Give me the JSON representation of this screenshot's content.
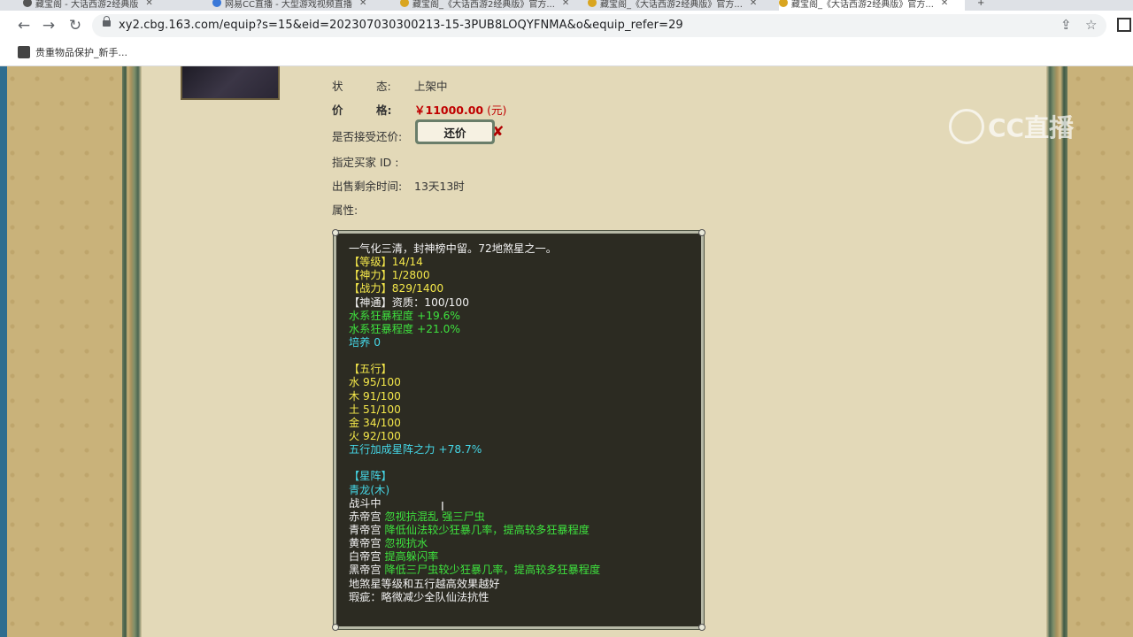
{
  "browser": {
    "tabs": [
      {
        "label": "藏宝阁 - 大话西游2经典版"
      },
      {
        "label": "网易CC直播 - 大型游戏视频直播"
      },
      {
        "label": "藏宝阁_《大话西游2经典版》官方..."
      },
      {
        "label": "藏宝阁_《大话西游2经典版》官方..."
      },
      {
        "label": "藏宝阁_《大话西游2经典版》官方..."
      }
    ],
    "url": "xy2.cbg.163.com/equip?s=15&eid=202307030300213-15-3PUB8LOQYFNMA&o&equip_refer=29",
    "bookmark": "贵重物品保护_新手..."
  },
  "watermark": {
    "text": "CC直播"
  },
  "item": {
    "status_label": "状　　　态:",
    "status_value": "上架中",
    "price_label": "价　　　格:",
    "price_value": "￥11000.00",
    "price_unit": "(元)",
    "counter_label": "是否接受还价:",
    "counter_button": "还价",
    "counter_mark": "✘",
    "buyer_label": "指定买家 ID :",
    "time_label": "出售剩余时间:",
    "time_value": "13天13时",
    "attr_label": "属性:"
  },
  "attributes": [
    {
      "text": "一气化三清，封神榜中留。72地煞星之一。",
      "color": "#f2f2f2"
    },
    {
      "text": "【等级】14/14",
      "color": "#f5e84a"
    },
    {
      "text": "【神力】1/2800",
      "color": "#f5e84a"
    },
    {
      "text": "【战力】829/1400",
      "color": "#f5e84a"
    },
    {
      "text": "【神通】资质：100/100",
      "color": "#f2f2f2"
    },
    {
      "text": "水系狂暴程度 +19.6%",
      "color": "#3ee23e"
    },
    {
      "text": "水系狂暴程度 +21.0%",
      "color": "#3ee23e"
    },
    {
      "text": "培养 0",
      "color": "#45d6e6"
    },
    {
      "text": "",
      "color": "#f2f2f2"
    },
    {
      "text": "【五行】",
      "color": "#f5e84a"
    },
    {
      "text": "水 95/100",
      "color": "#f5e84a"
    },
    {
      "text": "木 91/100",
      "color": "#f5e84a"
    },
    {
      "text": "土 51/100",
      "color": "#f5e84a"
    },
    {
      "text": "金 34/100",
      "color": "#f5e84a"
    },
    {
      "text": "火 92/100",
      "color": "#f5e84a"
    },
    {
      "text": "五行加成星阵之力 +78.7%",
      "color": "#45d6e6"
    },
    {
      "text": "",
      "color": "#f2f2f2"
    },
    {
      "text": "【星阵】",
      "color": "#45d6e6"
    },
    {
      "text": "青龙(木)",
      "color": "#45d6e6"
    },
    {
      "text": "战斗中",
      "color": "#f2f2f2"
    },
    {
      "text": "",
      "prefix": "赤帝宫 ",
      "suffix": "忽视抗混乱  强三尸虫",
      "color": "#3ee23e"
    },
    {
      "text": "",
      "prefix": "青帝宫 ",
      "suffix": "降低仙法较少狂暴几率，提高较多狂暴程度",
      "color": "#3ee23e"
    },
    {
      "text": "",
      "prefix": "黄帝宫 ",
      "suffix": "忽视抗水",
      "color": "#3ee23e"
    },
    {
      "text": "",
      "prefix": "白帝宫 ",
      "suffix": "提高躲闪率",
      "color": "#3ee23e"
    },
    {
      "text": "",
      "prefix": "黑帝宫 ",
      "suffix": "降低三尸虫较少狂暴几率，提高较多狂暴程度",
      "color": "#3ee23e"
    },
    {
      "text": "地煞星等级和五行越高效果越好",
      "color": "#f2f2f2"
    },
    {
      "text": "瑕疵：略微减少全队仙法抗性",
      "color": "#f2f2f2"
    }
  ]
}
